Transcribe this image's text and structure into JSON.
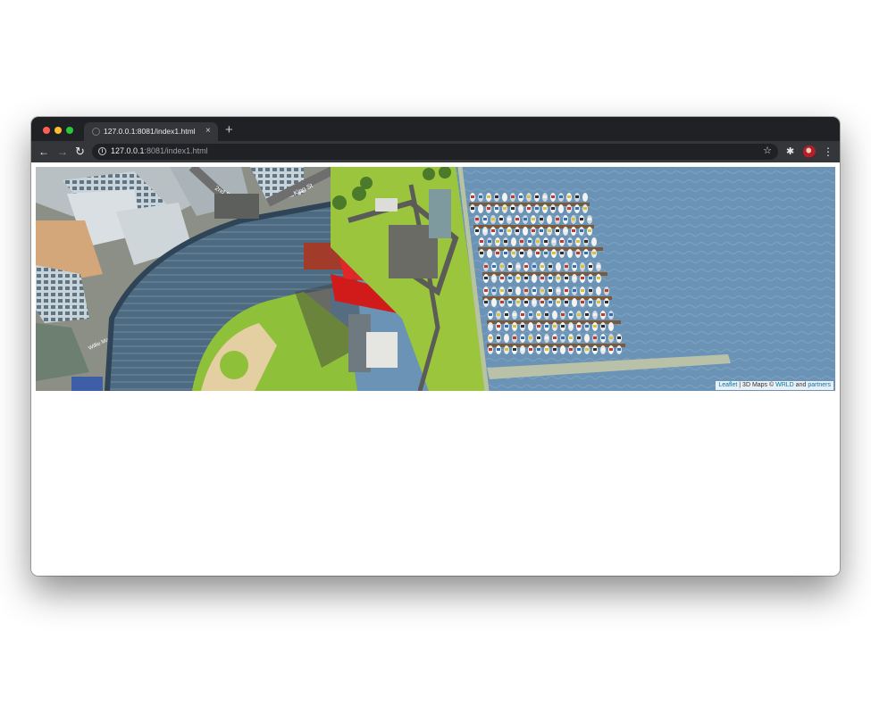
{
  "browser": {
    "tab_title": "127.0.0.1:8081/index1.html",
    "tab_close": "×",
    "new_tab": "+",
    "url_host": "127.0.0.1",
    "url_rest": ":8081/index1.html",
    "back_glyph": "←",
    "forward_glyph": "→",
    "reload_glyph": "↻",
    "star_glyph": "☆",
    "extensions_glyph": "✱",
    "menu_glyph": "⋮"
  },
  "map": {
    "street_labels": [
      "2nd St",
      "King St",
      "Willie Mays Plaza"
    ],
    "attribution": {
      "leaflet": "Leaflet",
      "separator": " | 3D Maps © ",
      "wrld": "WRLD",
      "and": " and ",
      "partners": "partners"
    }
  },
  "icons": {
    "info": "info-icon",
    "star": "star-icon",
    "extensions": "puzzle-icon",
    "menu": "kebab-menu-icon",
    "favicon": "globe-icon"
  },
  "colors": {
    "water": "#6b93b6",
    "grass": "#9bc53d",
    "stadium_seats": "#4e6a80",
    "red_structure": "#d11a1a",
    "tabstrip": "#202124",
    "toolbar": "#35363a"
  }
}
